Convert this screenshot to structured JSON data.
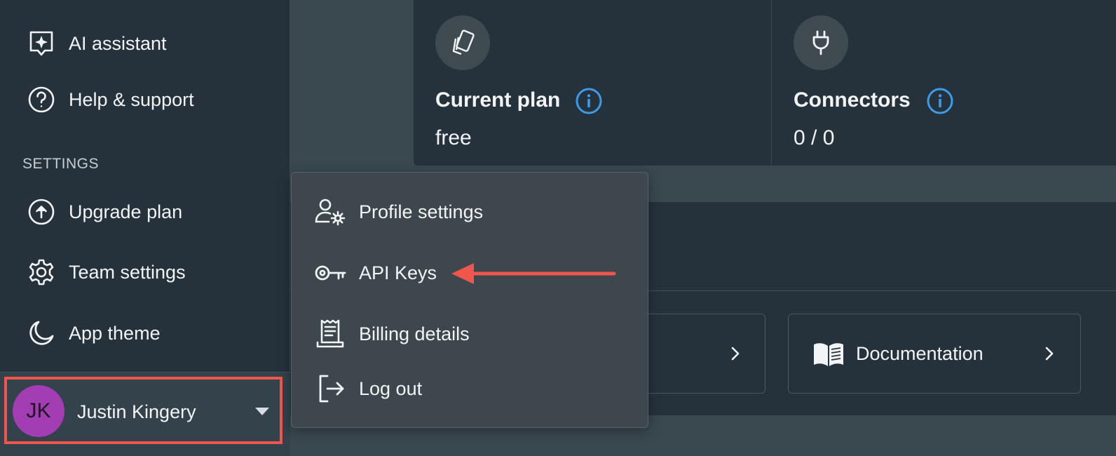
{
  "sidebar": {
    "items_top": [
      {
        "label": "AI assistant",
        "icon": "ai-assistant-icon"
      },
      {
        "label": "Help & support",
        "icon": "help-icon"
      }
    ],
    "section_label": "SETTINGS",
    "settings_items": [
      {
        "label": "Upgrade plan",
        "icon": "upgrade-icon"
      },
      {
        "label": "Team settings",
        "icon": "gear-icon"
      },
      {
        "label": "App theme",
        "icon": "moon-icon"
      }
    ],
    "user": {
      "initials": "JK",
      "name": "Justin Kingery",
      "avatar_color": "#a23db3"
    }
  },
  "stats": [
    {
      "title": "Current plan",
      "value": "free",
      "icon": "cards-icon"
    },
    {
      "title": "Connectors",
      "value": "0 / 0",
      "icon": "plug-icon"
    }
  ],
  "links": {
    "documentation_label": "Documentation"
  },
  "user_menu": {
    "items": [
      {
        "label": "Profile settings",
        "icon": "profile-settings-icon"
      },
      {
        "label": "API Keys",
        "icon": "key-icon"
      },
      {
        "label": "Billing details",
        "icon": "receipt-icon"
      },
      {
        "label": "Log out",
        "icon": "logout-icon"
      }
    ]
  },
  "colors": {
    "highlight": "#f0564c",
    "info_blue": "#3d9be9",
    "sidebar_bg": "#26323b",
    "menu_bg": "#3d474d"
  }
}
